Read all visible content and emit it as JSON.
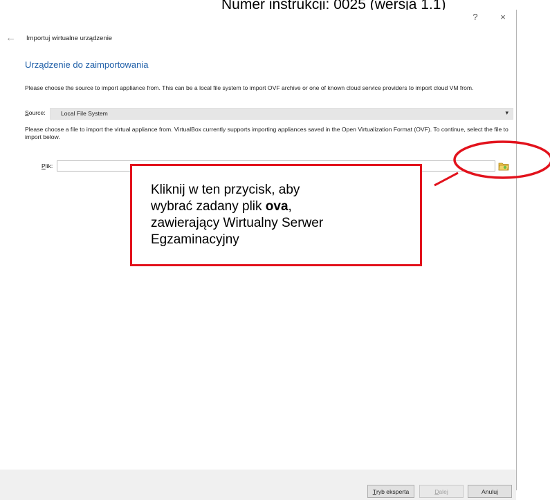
{
  "doc_header": "Numer instrukcji: 0025 (wersja 1.1)",
  "window": {
    "help_glyph": "?",
    "close_glyph": "×"
  },
  "wizard": {
    "back_glyph": "←",
    "title": "Importuj wirtualne urządzenie",
    "page_title": "Urządzenie do zaimportowania",
    "source_description": "Please choose the source to import appliance from. This can be a local file system to import OVF archive or one of known cloud service providers to import cloud VM from.",
    "source_label_key": "S",
    "source_label_rest": "ource:",
    "source_value": "Local File System",
    "file_description": "Please choose a file to import the virtual appliance from. VirtualBox currently supports importing appliances saved in the Open Virtualization Format (OVF). To continue, select the file to import below.",
    "file_label_key": "P",
    "file_label_rest": "lik:",
    "file_value": ""
  },
  "annotation": {
    "line1": "Kliknij w ten przycisk, aby",
    "line2_pre": "wybrać zadany plik ",
    "line2_bold": "ova",
    "line2_post": ",",
    "line3": "zawierający Wirtualny Serwer",
    "line4": "Egzaminacyjny",
    "color": "#e2121c"
  },
  "footer": {
    "expert_key": "T",
    "expert_rest": "ryb eksperta",
    "next_key": "D",
    "next_rest": "alej",
    "cancel_label": "Anuluj"
  },
  "colors": {
    "accent_title": "#1f5fa8",
    "select_bg": "#e6e6e6",
    "footer_bg": "#f0f0f0"
  }
}
